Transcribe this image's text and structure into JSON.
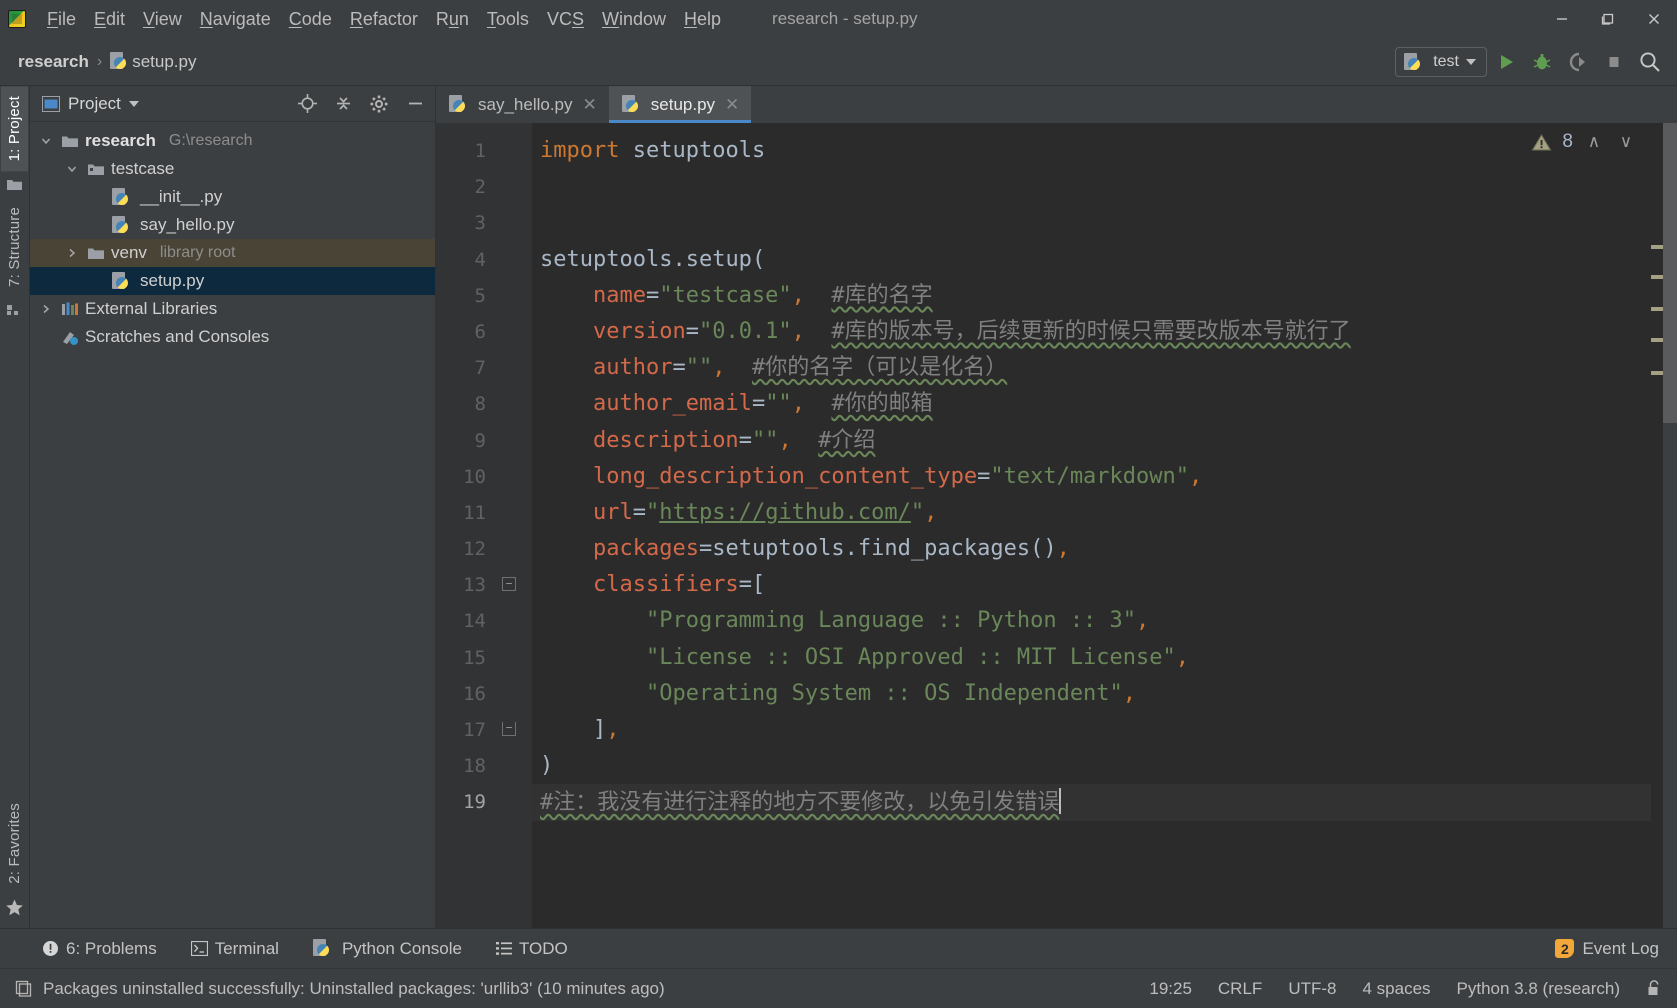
{
  "window": {
    "title": "research - setup.py",
    "app_icon": "pycharm-icon",
    "controls": {
      "minimize": "–",
      "maximize": "❐",
      "close": "✕"
    }
  },
  "menubar": {
    "items": [
      {
        "label": "File",
        "mnemonic": "F"
      },
      {
        "label": "Edit",
        "mnemonic": "E"
      },
      {
        "label": "View",
        "mnemonic": "V"
      },
      {
        "label": "Navigate",
        "mnemonic": "N"
      },
      {
        "label": "Code",
        "mnemonic": "C"
      },
      {
        "label": "Refactor",
        "mnemonic": "R"
      },
      {
        "label": "Run",
        "mnemonic": "u"
      },
      {
        "label": "Tools",
        "mnemonic": "T"
      },
      {
        "label": "VCS",
        "mnemonic": "S"
      },
      {
        "label": "Window",
        "mnemonic": "W"
      },
      {
        "label": "Help",
        "mnemonic": "H"
      }
    ]
  },
  "navbar": {
    "breadcrumbs": [
      {
        "label": "research",
        "icon": "none"
      },
      {
        "label": "setup.py",
        "icon": "python-file-icon"
      }
    ],
    "separator": "›",
    "run_config": {
      "label": "test",
      "icon": "python-icon"
    },
    "actions": [
      {
        "name": "run-button",
        "icon": "play-icon"
      },
      {
        "name": "debug-button",
        "icon": "bug-icon"
      },
      {
        "name": "run-with-coverage-button",
        "icon": "coverage-icon"
      },
      {
        "name": "stop-button",
        "icon": "stop-icon"
      },
      {
        "name": "search-everywhere-button",
        "icon": "search-icon"
      }
    ]
  },
  "left_strip": {
    "top_tabs": [
      {
        "label": "1: Project",
        "mnemonic": "1",
        "active": true
      },
      {
        "label": "7: Structure",
        "mnemonic": "7",
        "active": false
      }
    ],
    "bottom_tabs": [
      {
        "label": "2: Favorites",
        "mnemonic": "2",
        "active": false
      }
    ]
  },
  "project_panel": {
    "title": "Project",
    "header_icons": [
      "locate-icon",
      "collapse-all-icon",
      "settings-gear-icon",
      "hide-icon"
    ],
    "tree": [
      {
        "indent": 0,
        "arrow": "down",
        "icon": "folder-icon",
        "label": "research",
        "detail": "G:\\research",
        "bold": true,
        "state": "normal"
      },
      {
        "indent": 1,
        "arrow": "down",
        "icon": "package-folder-icon",
        "label": "testcase",
        "detail": "",
        "bold": false,
        "state": "normal"
      },
      {
        "indent": 2,
        "arrow": "none",
        "icon": "python-file-icon",
        "label": "__init__.py",
        "detail": "",
        "bold": false,
        "state": "normal"
      },
      {
        "indent": 2,
        "arrow": "none",
        "icon": "python-file-icon",
        "label": "say_hello.py",
        "detail": "",
        "bold": false,
        "state": "normal"
      },
      {
        "indent": 1,
        "arrow": "right",
        "icon": "folder-icon",
        "label": "venv",
        "detail": "library root",
        "bold": false,
        "state": "hover"
      },
      {
        "indent": 2,
        "arrow": "none",
        "icon": "python-file-icon",
        "label": "setup.py",
        "detail": "",
        "bold": false,
        "state": "selected"
      },
      {
        "indent": 0,
        "arrow": "right",
        "icon": "external-libraries-icon",
        "label": "External Libraries",
        "detail": "",
        "bold": false,
        "state": "normal"
      },
      {
        "indent": 0,
        "arrow": "none",
        "icon": "scratches-icon",
        "label": "Scratches and Consoles",
        "detail": "",
        "bold": false,
        "state": "normal"
      }
    ]
  },
  "editor": {
    "tabs": [
      {
        "label": "say_hello.py",
        "icon": "python-file-icon",
        "active": false,
        "close": "✕"
      },
      {
        "label": "setup.py",
        "icon": "python-file-icon",
        "active": true,
        "close": "✕"
      }
    ],
    "inspection": {
      "icon": "warning-triangle-icon",
      "count": "8",
      "prev": "∧",
      "next": "∨"
    },
    "line_numbers": [
      "1",
      "2",
      "3",
      "4",
      "5",
      "6",
      "7",
      "8",
      "9",
      "10",
      "11",
      "12",
      "13",
      "14",
      "15",
      "16",
      "17",
      "18",
      "19"
    ],
    "current_line": 19,
    "fold_markers": [
      {
        "line": 13,
        "glyph": "−"
      },
      {
        "line": 17,
        "glyph": "−"
      }
    ],
    "code_lines": [
      {
        "n": 1,
        "tokens": [
          {
            "t": "kw",
            "v": "import"
          },
          {
            "t": "op",
            "v": " "
          },
          {
            "t": "id",
            "v": "setuptools"
          }
        ]
      },
      {
        "n": 2,
        "tokens": []
      },
      {
        "n": 3,
        "tokens": []
      },
      {
        "n": 4,
        "tokens": [
          {
            "t": "id",
            "v": "setuptools"
          },
          {
            "t": "op",
            "v": "."
          },
          {
            "t": "id",
            "v": "setup"
          },
          {
            "t": "op",
            "v": "("
          }
        ]
      },
      {
        "n": 5,
        "tokens": [
          {
            "t": "op",
            "v": "    "
          },
          {
            "t": "param",
            "v": "name"
          },
          {
            "t": "op",
            "v": "="
          },
          {
            "t": "str",
            "v": "\"testcase\""
          },
          {
            "t": "comma",
            "v": ","
          },
          {
            "t": "op",
            "v": "  "
          },
          {
            "t": "cmt",
            "v": "#库的名字"
          }
        ]
      },
      {
        "n": 6,
        "tokens": [
          {
            "t": "op",
            "v": "    "
          },
          {
            "t": "param",
            "v": "version"
          },
          {
            "t": "op",
            "v": "="
          },
          {
            "t": "str",
            "v": "\"0.0.1\""
          },
          {
            "t": "comma",
            "v": ","
          },
          {
            "t": "op",
            "v": "  "
          },
          {
            "t": "cmt",
            "v": "#库的版本号，后续更新的时候只需要改版本号就行了"
          }
        ]
      },
      {
        "n": 7,
        "tokens": [
          {
            "t": "op",
            "v": "    "
          },
          {
            "t": "param",
            "v": "author"
          },
          {
            "t": "op",
            "v": "="
          },
          {
            "t": "str",
            "v": "\"\""
          },
          {
            "t": "comma",
            "v": ","
          },
          {
            "t": "op",
            "v": "  "
          },
          {
            "t": "cmt",
            "v": "#你的名字（可以是化名）"
          }
        ]
      },
      {
        "n": 8,
        "tokens": [
          {
            "t": "op",
            "v": "    "
          },
          {
            "t": "param",
            "v": "author_email"
          },
          {
            "t": "op",
            "v": "="
          },
          {
            "t": "str",
            "v": "\"\""
          },
          {
            "t": "comma",
            "v": ","
          },
          {
            "t": "op",
            "v": "  "
          },
          {
            "t": "cmt",
            "v": "#你的邮箱"
          }
        ]
      },
      {
        "n": 9,
        "tokens": [
          {
            "t": "op",
            "v": "    "
          },
          {
            "t": "param",
            "v": "description"
          },
          {
            "t": "op",
            "v": "="
          },
          {
            "t": "str",
            "v": "\"\""
          },
          {
            "t": "comma",
            "v": ","
          },
          {
            "t": "op",
            "v": "  "
          },
          {
            "t": "cmt",
            "v": "#介绍"
          }
        ]
      },
      {
        "n": 10,
        "tokens": [
          {
            "t": "op",
            "v": "    "
          },
          {
            "t": "param",
            "v": "long_description_content_type"
          },
          {
            "t": "op",
            "v": "="
          },
          {
            "t": "str",
            "v": "\"text/markdown\""
          },
          {
            "t": "comma",
            "v": ","
          }
        ]
      },
      {
        "n": 11,
        "tokens": [
          {
            "t": "op",
            "v": "    "
          },
          {
            "t": "param",
            "v": "url"
          },
          {
            "t": "op",
            "v": "="
          },
          {
            "t": "str",
            "v": "\""
          },
          {
            "t": "lnk",
            "v": "https://github.com/"
          },
          {
            "t": "str",
            "v": "\""
          },
          {
            "t": "comma",
            "v": ","
          }
        ]
      },
      {
        "n": 12,
        "tokens": [
          {
            "t": "op",
            "v": "    "
          },
          {
            "t": "param",
            "v": "packages"
          },
          {
            "t": "op",
            "v": "="
          },
          {
            "t": "id",
            "v": "setuptools"
          },
          {
            "t": "op",
            "v": "."
          },
          {
            "t": "id",
            "v": "find_packages"
          },
          {
            "t": "op",
            "v": "()"
          },
          {
            "t": "comma",
            "v": ","
          }
        ]
      },
      {
        "n": 13,
        "tokens": [
          {
            "t": "op",
            "v": "    "
          },
          {
            "t": "param",
            "v": "classifiers"
          },
          {
            "t": "op",
            "v": "=["
          }
        ]
      },
      {
        "n": 14,
        "tokens": [
          {
            "t": "op",
            "v": "        "
          },
          {
            "t": "str",
            "v": "\"Programming Language :: Python :: 3\""
          },
          {
            "t": "comma",
            "v": ","
          }
        ]
      },
      {
        "n": 15,
        "tokens": [
          {
            "t": "op",
            "v": "        "
          },
          {
            "t": "str",
            "v": "\"License :: OSI Approved :: MIT License\""
          },
          {
            "t": "comma",
            "v": ","
          }
        ]
      },
      {
        "n": 16,
        "tokens": [
          {
            "t": "op",
            "v": "        "
          },
          {
            "t": "str",
            "v": "\"Operating System :: OS Independent\""
          },
          {
            "t": "comma",
            "v": ","
          }
        ]
      },
      {
        "n": 17,
        "tokens": [
          {
            "t": "op",
            "v": "    ]"
          },
          {
            "t": "comma",
            "v": ","
          }
        ]
      },
      {
        "n": 18,
        "tokens": [
          {
            "t": "op",
            "v": ")"
          }
        ]
      },
      {
        "n": 19,
        "tokens": [
          {
            "t": "cmt",
            "v": "#注：我没有进行注释的地方不要修改，以免引发错误"
          }
        ]
      }
    ]
  },
  "bottom_tool_window": {
    "items": [
      {
        "label": "6: Problems",
        "mnemonic": "6",
        "icon": "error-circle-icon"
      },
      {
        "label": "Terminal",
        "mnemonic": "",
        "icon": "terminal-icon"
      },
      {
        "label": "Python Console",
        "mnemonic": "",
        "icon": "python-icon"
      },
      {
        "label": "TODO",
        "mnemonic": "",
        "icon": "todo-list-icon"
      }
    ],
    "event_log": {
      "label": "Event Log",
      "badge": "2"
    }
  },
  "statusbar": {
    "icon": "message-icon",
    "message": "Packages uninstalled successfully: Uninstalled packages: 'urllib3' (10 minutes ago)",
    "right": {
      "position": "19:25",
      "line_separator": "CRLF",
      "encoding": "UTF-8",
      "indent": "4 spaces",
      "interpreter": "Python 3.8 (research)",
      "lock_icon": "unlocked-icon"
    }
  },
  "colors": {
    "bg_chrome": "#3c3f41",
    "bg_editor": "#2b2b2b",
    "bg_gutter": "#313335",
    "accent_tab": "#4a88c7",
    "selection": "#0d293e",
    "hover_row": "#4a4436",
    "keyword": "#cc7832",
    "param": "#d4694a",
    "string": "#6a8759",
    "comment": "#808080",
    "identifier": "#a9b7c6",
    "badge": "#f2a73b",
    "warning": "#a3a083"
  }
}
